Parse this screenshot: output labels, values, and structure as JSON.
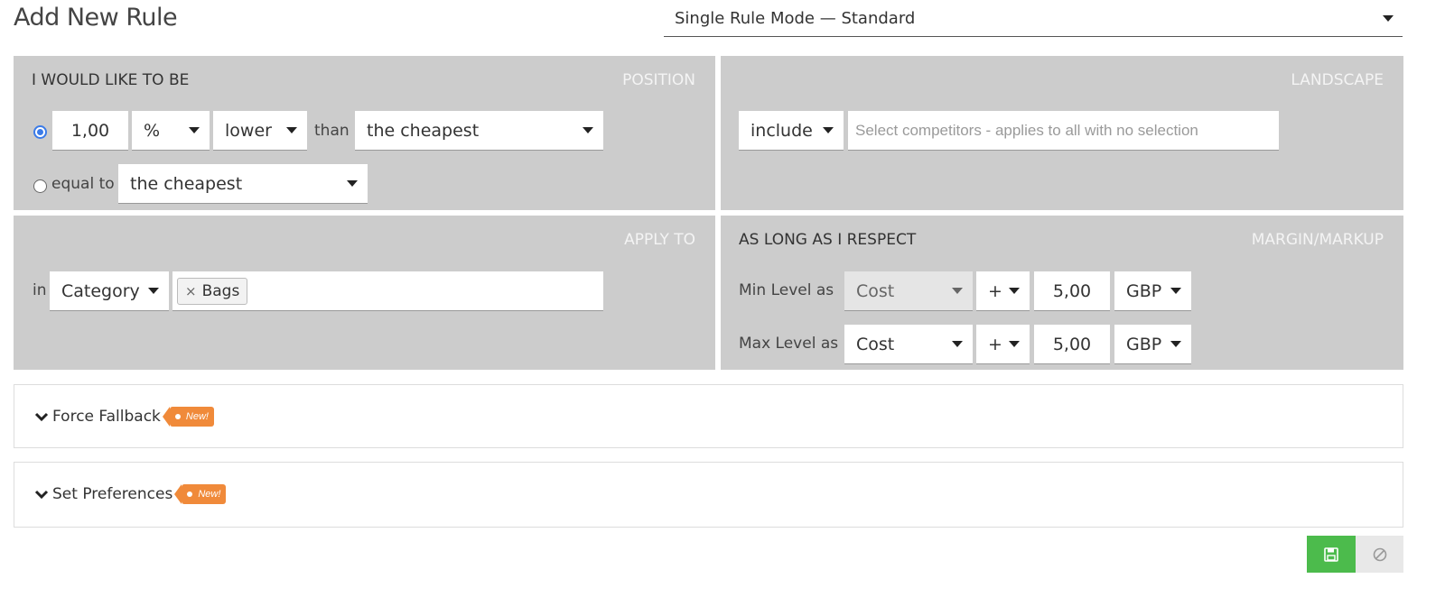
{
  "header": {
    "title": "Add New Rule",
    "mode_value": "Single Rule Mode — Standard"
  },
  "position_panel": {
    "title": "I WOULD LIKE TO BE",
    "tag": "POSITION",
    "amount_value": "1,00",
    "unit_value": "%",
    "direction_value": "lower",
    "than_label": "than",
    "than_target_value": "the cheapest",
    "equal_label": "equal to",
    "equal_target_value": "the cheapest",
    "selected_option": "relative"
  },
  "landscape_panel": {
    "tag": "LANDSCAPE",
    "include_value": "include",
    "competitors_placeholder": "Select competitors - applies to all with no selection"
  },
  "apply_panel": {
    "tag": "APPLY TO",
    "in_label": "in",
    "scope_value": "Category",
    "selected_tags": [
      "Bags"
    ]
  },
  "margin_panel": {
    "title": "AS LONG AS I RESPECT",
    "tag": "MARGIN/MARKUP",
    "min": {
      "label": "Min Level as",
      "basis": "Cost",
      "operator": "+",
      "amount": "5,00",
      "currency": "GBP"
    },
    "max": {
      "label": "Max Level as",
      "basis": "Cost",
      "operator": "+",
      "amount": "5,00",
      "currency": "GBP"
    }
  },
  "accordions": [
    {
      "label": "Force Fallback",
      "badge": "New!"
    },
    {
      "label": "Set Preferences",
      "badge": "New!"
    }
  ],
  "colors": {
    "panel_bg": "#cccccc",
    "save_button": "#4cbb4c",
    "badge": "#f08a3a",
    "radio_accent": "#3b7be8"
  },
  "icons": {
    "save": "floppy-disk-icon",
    "cancel": "prohibited-icon",
    "accordion": "chevron-down-icon",
    "dropdown": "caret-down-icon"
  }
}
